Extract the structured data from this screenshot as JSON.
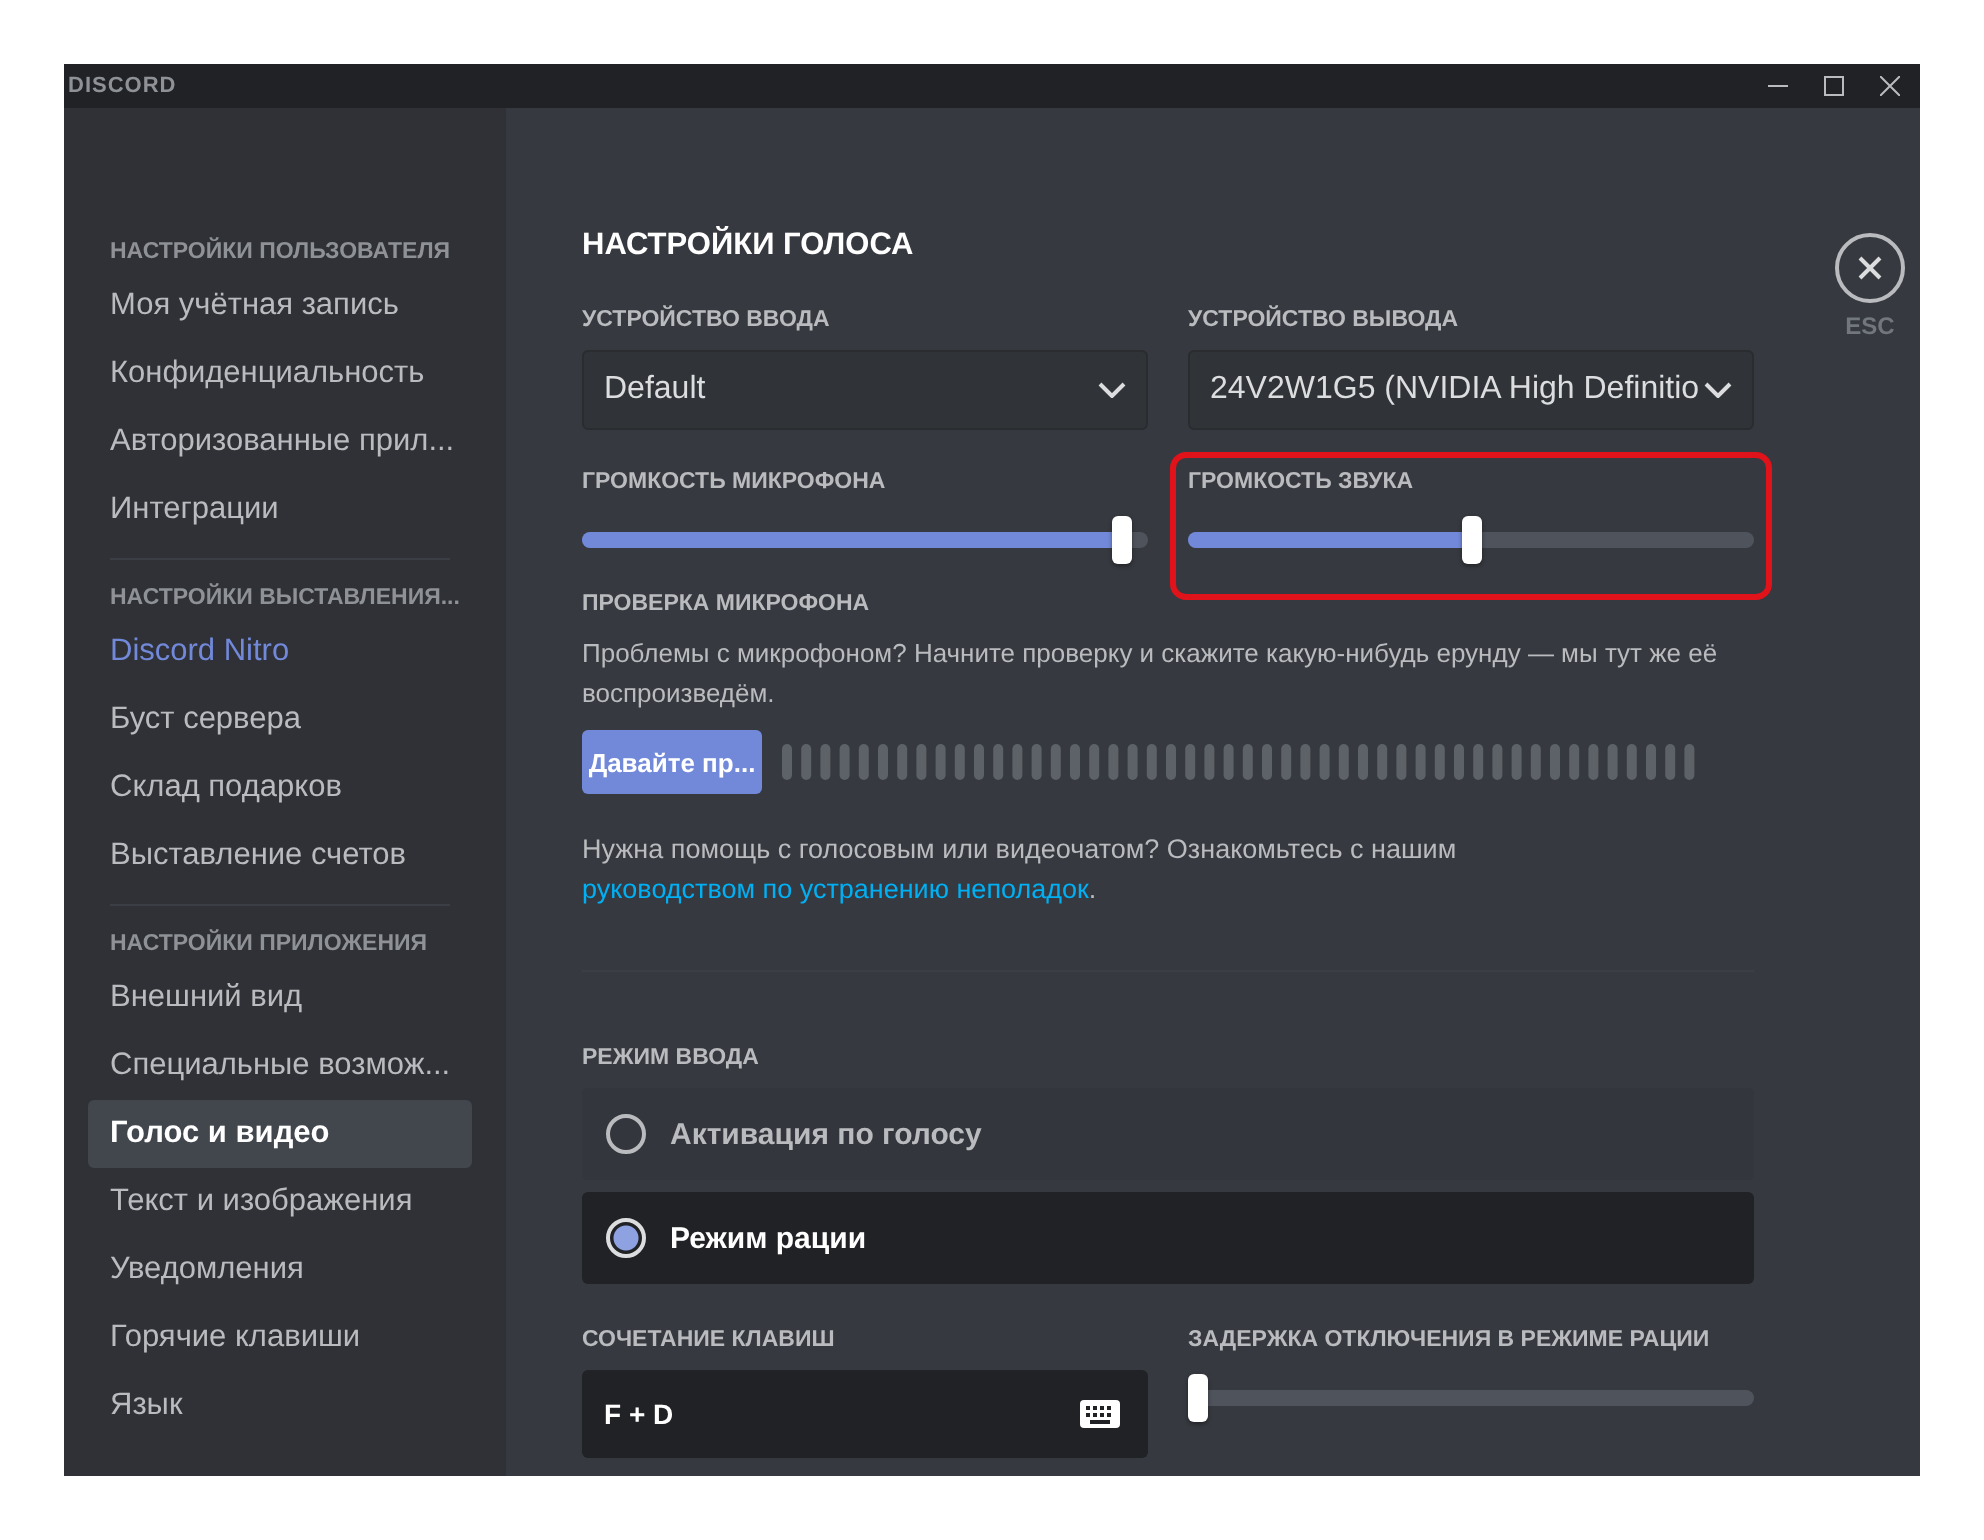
{
  "window": {
    "title": "DISCORD"
  },
  "sidebar": {
    "sections": [
      {
        "header": "НАСТРОЙКИ ПОЛЬЗОВАТЕЛЯ",
        "items": [
          {
            "label": "Моя учётная запись",
            "selected": false
          },
          {
            "label": "Конфиденциальность",
            "selected": false
          },
          {
            "label": "Авторизованные прил...",
            "selected": false
          },
          {
            "label": "Интеграции",
            "selected": false
          }
        ]
      },
      {
        "header": "НАСТРОЙКИ ВЫСТАВЛЕНИЯ...",
        "items": [
          {
            "label": "Discord Nitro",
            "selected": false,
            "kind": "nitro"
          },
          {
            "label": "Буст сервера",
            "selected": false
          },
          {
            "label": "Склад подарков",
            "selected": false
          },
          {
            "label": "Выставление счетов",
            "selected": false
          }
        ]
      },
      {
        "header": "НАСТРОЙКИ ПРИЛОЖЕНИЯ",
        "items": [
          {
            "label": "Внешний вид",
            "selected": false
          },
          {
            "label": "Специальные возмож...",
            "selected": false
          },
          {
            "label": "Голос и видео",
            "selected": true
          },
          {
            "label": "Текст и изображения",
            "selected": false
          },
          {
            "label": "Уведомления",
            "selected": false
          },
          {
            "label": "Горячие клавиши",
            "selected": false
          },
          {
            "label": "Язык",
            "selected": false
          }
        ]
      }
    ]
  },
  "main": {
    "title": "НАСТРОЙКИ ГОЛОСА",
    "close_label": "ESC",
    "devices": [
      {
        "label": "УСТРОЙСТВО ВВОДА",
        "value": "Default"
      },
      {
        "label": "УСТРОЙСТВО ВЫВОДА",
        "value": "24V2W1G5 (NVIDIA High Definitio"
      }
    ],
    "volumes": [
      {
        "label": "ГРОМКОСТЬ МИКРОФОНА",
        "level": 0.97
      },
      {
        "label": "ГРОМКОСТЬ ЗВУКА",
        "level": 0.5,
        "highlighted": true
      }
    ],
    "mic_test": {
      "label": "ПРОВЕРКА МИКРОФОНА",
      "description": "Проблемы с микрофоном? Начните проверку и скажите какую-нибудь ерунду — мы тут же её воспроизведём.",
      "button": "Давайте пр..."
    },
    "help": {
      "text": "Нужна помощь с голосовым или видеочатом? Ознакомьтесь с нашим",
      "link": "руководством по устранению неполадок",
      "after": "."
    },
    "input_mode": {
      "label": "РЕЖИМ ВВОДА",
      "options": [
        {
          "label": "Активация по голосу",
          "selected": false
        },
        {
          "label": "Режим рации",
          "selected": true
        }
      ]
    },
    "shortcut": {
      "label": "СОЧЕТАНИЕ КЛАВИШ",
      "value": "F + D"
    },
    "release_delay": {
      "label": "ЗАДЕРЖКА ОТКЛЮЧЕНИЯ В РЕЖИМЕ РАЦИИ",
      "level": 0
    }
  }
}
